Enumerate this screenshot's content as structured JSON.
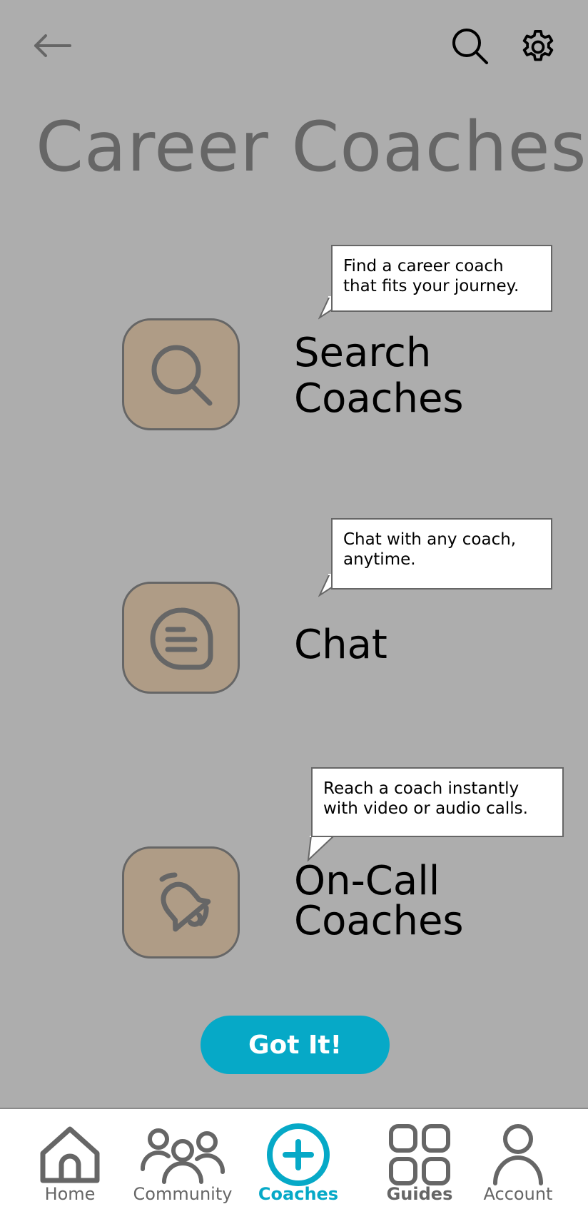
{
  "header": {
    "title": "Career Coaches",
    "back_icon": "arrow-left-icon",
    "search_icon": "search-icon",
    "settings_icon": "gear-icon"
  },
  "features": [
    {
      "label": "Search Coaches",
      "icon": "search-icon",
      "tooltip": "Find a career coach\nthat fits your journey."
    },
    {
      "label": "Chat",
      "icon": "chat-bubble-icon",
      "tooltip": "Chat with any coach,\nanytime."
    },
    {
      "label": "On-Call Coaches",
      "icon": "bell-ringing-icon",
      "tooltip": "Reach a coach instantly\nwith video or audio calls."
    }
  ],
  "cta": {
    "label": "Got It!"
  },
  "nav": {
    "items": [
      {
        "label": "Home",
        "icon": "home-icon"
      },
      {
        "label": "Community",
        "icon": "community-icon"
      },
      {
        "label": "Coaches",
        "icon": "plus-circle-icon",
        "active": true
      },
      {
        "label": "Guides",
        "icon": "grid-icon"
      },
      {
        "label": "Account",
        "icon": "user-icon"
      }
    ]
  },
  "colors": {
    "background": "#ADADAD",
    "tile": "#AF9C86",
    "accent": "#06A9C7",
    "icon_gray": "#666666"
  }
}
